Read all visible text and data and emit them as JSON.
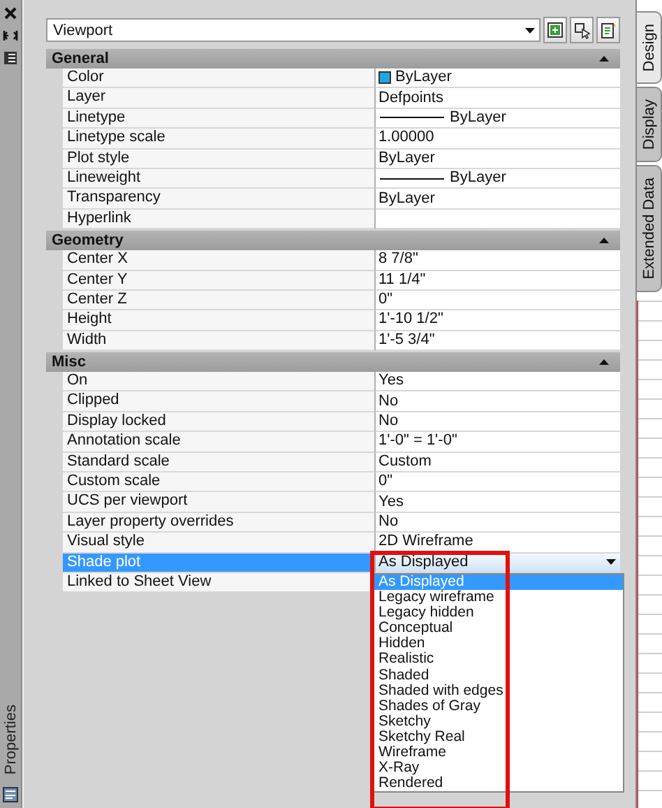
{
  "palette": {
    "title": "Properties"
  },
  "object_selector": {
    "value": "Viewport"
  },
  "side_tabs": [
    {
      "label": "Design",
      "selected": true
    },
    {
      "label": "Display",
      "selected": false
    },
    {
      "label": "Extended Data",
      "selected": false
    }
  ],
  "sections": [
    {
      "title": "General",
      "expanded": true,
      "rows": [
        {
          "label": "Color",
          "value": "ByLayer",
          "kind": "color",
          "color": "#1ea7e1",
          "selected": false
        },
        {
          "label": "Layer",
          "value": "Defpoints",
          "kind": "text",
          "selected": false
        },
        {
          "label": "Linetype",
          "value": "ByLayer",
          "kind": "line",
          "selected": false
        },
        {
          "label": "Linetype scale",
          "value": "1.00000",
          "kind": "text",
          "selected": false
        },
        {
          "label": "Plot style",
          "value": "ByLayer",
          "kind": "text",
          "selected": false
        },
        {
          "label": "Lineweight",
          "value": "ByLayer",
          "kind": "line",
          "selected": false
        },
        {
          "label": "Transparency",
          "value": "ByLayer",
          "kind": "text",
          "selected": false
        },
        {
          "label": "Hyperlink",
          "kind": "text",
          "selected": false
        }
      ]
    },
    {
      "title": "Geometry",
      "expanded": true,
      "rows": [
        {
          "label": "Center X",
          "value": "8 7/8\"",
          "kind": "text",
          "selected": false
        },
        {
          "label": "Center Y",
          "value": "11 1/4\"",
          "kind": "text",
          "selected": false
        },
        {
          "label": "Center Z",
          "value": "0\"",
          "kind": "text",
          "selected": false
        },
        {
          "label": "Height",
          "value": "1'-10 1/2\"",
          "kind": "text",
          "selected": false
        },
        {
          "label": "Width",
          "value": "1'-5 3/4\"",
          "kind": "text",
          "selected": false
        }
      ]
    },
    {
      "title": "Misc",
      "expanded": true,
      "rows": [
        {
          "label": "On",
          "value": "Yes",
          "kind": "text",
          "selected": false
        },
        {
          "label": "Clipped",
          "value": "No",
          "kind": "text",
          "selected": false
        },
        {
          "label": "Display locked",
          "value": "No",
          "kind": "text",
          "selected": false
        },
        {
          "label": "Annotation scale",
          "value": "1'-0\" = 1'-0\"",
          "kind": "text",
          "selected": false
        },
        {
          "label": "Standard scale",
          "value": "Custom",
          "kind": "text",
          "selected": false
        },
        {
          "label": "Custom scale",
          "value": "0\"",
          "kind": "text",
          "selected": false
        },
        {
          "label": "UCS per viewport",
          "value": "Yes",
          "kind": "text",
          "selected": false
        },
        {
          "label": "Layer property overrides",
          "value": "No",
          "kind": "text",
          "selected": false
        },
        {
          "label": "Visual style",
          "value": "2D Wireframe",
          "kind": "text",
          "selected": false
        },
        {
          "label": "Shade plot",
          "value": "As Displayed",
          "kind": "dropdown",
          "selected": true,
          "dropdown": {
            "highlighted": true,
            "options": [
              {
                "label": "As Displayed",
                "selected": true
              },
              {
                "label": "Legacy wireframe",
                "selected": false
              },
              {
                "label": "Legacy hidden",
                "selected": false
              },
              {
                "label": "Conceptual",
                "selected": false
              },
              {
                "label": "Hidden",
                "selected": false
              },
              {
                "label": "Realistic",
                "selected": false
              },
              {
                "label": "Shaded",
                "selected": false
              },
              {
                "label": "Shaded with edges",
                "selected": false
              },
              {
                "label": "Shades of Gray",
                "selected": false
              },
              {
                "label": "Sketchy",
                "selected": false
              },
              {
                "label": "Sketchy Real",
                "selected": false
              },
              {
                "label": "Wireframe",
                "selected": false
              },
              {
                "label": "X-Ray",
                "selected": false
              },
              {
                "label": "Rendered",
                "selected": false
              }
            ]
          }
        },
        {
          "label": "Linked to Sheet View",
          "kind": "text",
          "selected": false
        }
      ]
    }
  ]
}
